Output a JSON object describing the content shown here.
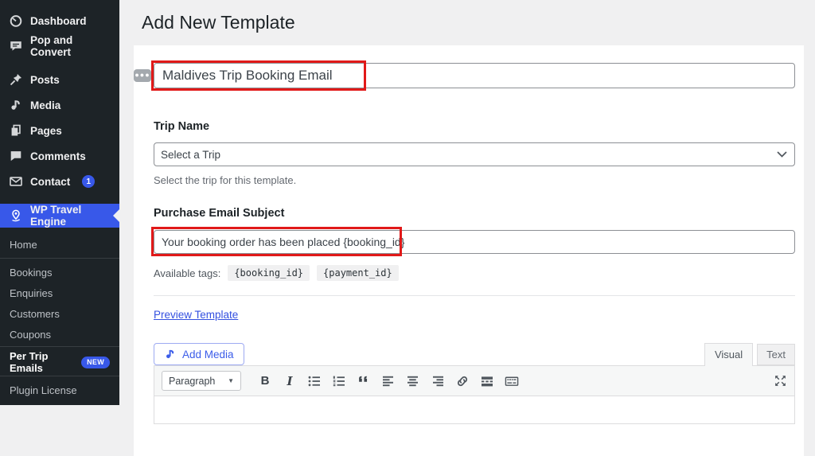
{
  "sidebar": {
    "items": [
      {
        "label": "Dashboard"
      },
      {
        "label": "Pop and Convert"
      },
      {
        "label": "Posts"
      },
      {
        "label": "Media"
      },
      {
        "label": "Pages"
      },
      {
        "label": "Comments"
      },
      {
        "label": "Contact",
        "badge": "1"
      },
      {
        "label": "WP Travel Engine"
      }
    ],
    "submenu": [
      "Home",
      "Bookings",
      "Enquiries",
      "Customers",
      "Coupons",
      "Per Trip Emails",
      "Plugin License"
    ],
    "per_trip_badge": "NEW"
  },
  "page": {
    "title": "Add New Template"
  },
  "form": {
    "template_title": {
      "value": "Maldives Trip Booking Email"
    },
    "trip_name": {
      "label": "Trip Name",
      "selected": "Select a Trip",
      "help": "Select the trip for this template."
    },
    "email_subject": {
      "label": "Purchase Email Subject",
      "value": "Your booking order has been placed {booking_id}",
      "tags_label": "Available tags:",
      "tags": [
        "{booking_id}",
        "{payment_id}"
      ]
    },
    "preview_link": "Preview Template"
  },
  "editor": {
    "add_media_label": "Add Media",
    "tab_visual": "Visual",
    "tab_text": "Text",
    "paragraph_label": "Paragraph",
    "bold_glyph": "B",
    "italic_glyph": "I"
  },
  "colors": {
    "accent_blue": "#3858e9",
    "annotation_red": "#e11919",
    "sidebar_bg": "#1d2327",
    "link_blue": "#3450e0"
  }
}
